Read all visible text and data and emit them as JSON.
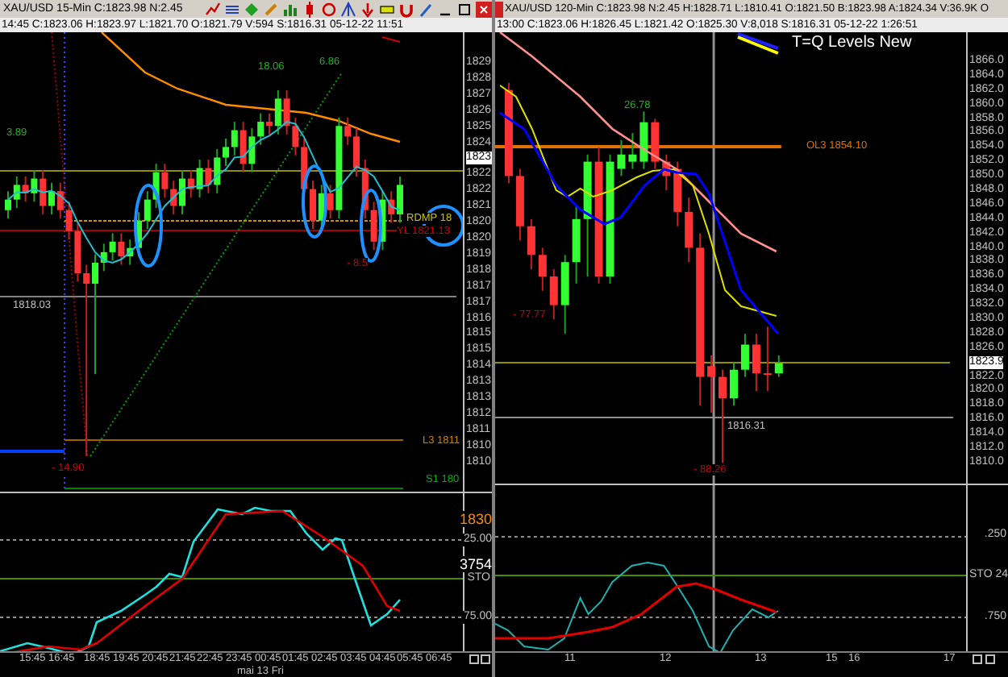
{
  "left_chart": {
    "title": "XAU/USD  15-Min  C:1823.98  N:2.45",
    "info": "14:45  C:1823.06  H:1823.97  L:1821.70  O:1821.79  V:594  S:1816.31  05-12-22  11:51",
    "price_labels": [
      {
        "text": "1829",
        "kind": "tick"
      },
      {
        "text": "1828",
        "kind": "tick"
      },
      {
        "text": "1827",
        "kind": "tick"
      },
      {
        "text": "1826",
        "kind": "tick"
      },
      {
        "text": "1825",
        "kind": "tick"
      },
      {
        "text": "1824",
        "kind": "tick"
      },
      {
        "text": "1823",
        "kind": "current"
      },
      {
        "text": "1822",
        "kind": "tick"
      },
      {
        "text": "1822",
        "kind": "tick"
      },
      {
        "text": "1821",
        "kind": "tick"
      },
      {
        "text": "1820",
        "kind": "tick"
      },
      {
        "text": "1820",
        "kind": "tick"
      },
      {
        "text": "1819",
        "kind": "tick"
      },
      {
        "text": "1818",
        "kind": "tick"
      },
      {
        "text": "1817",
        "kind": "tick"
      },
      {
        "text": "1817",
        "kind": "tick"
      },
      {
        "text": "1816",
        "kind": "tick"
      },
      {
        "text": "1815",
        "kind": "tick"
      },
      {
        "text": "1815",
        "kind": "tick"
      },
      {
        "text": "1814",
        "kind": "tick"
      },
      {
        "text": "1813",
        "kind": "tick"
      },
      {
        "text": "1813",
        "kind": "tick"
      },
      {
        "text": "1812",
        "kind": "tick"
      },
      {
        "text": "1811",
        "kind": "tick"
      },
      {
        "text": "1810",
        "kind": "tick"
      },
      {
        "text": "1810",
        "kind": "tick"
      }
    ],
    "annotations": [
      {
        "text": "3.89",
        "color": "#20b020"
      },
      {
        "text": "18.06",
        "color": "#20b020"
      },
      {
        "text": "6.86",
        "color": "#20b020"
      },
      {
        "text": "RDMP 18",
        "color": "#c8c000"
      },
      {
        "text": "YL 1821.13",
        "color": "#c80000"
      },
      {
        "text": "- 8.5",
        "color": "#c80000"
      },
      {
        "text": "1818.03",
        "color": "#c0c0c0"
      },
      {
        "text": "L3 1811",
        "color": "#c88000"
      },
      {
        "text": "- 14.90",
        "color": "#d00000"
      },
      {
        "text": "S1 180",
        "color": "#00b000"
      }
    ],
    "indicator_labels": [
      {
        "text": "1830",
        "color": "#ff8c00"
      },
      {
        "text": "25.00",
        "color": "#c0c0c0"
      },
      {
        "text": "3754",
        "color": "#ffffff"
      },
      {
        "text": "STO",
        "color": "#c0c0c0"
      },
      {
        "text": "75.00",
        "color": "#c0c0c0"
      }
    ],
    "time_labels": [
      "15:45",
      "16:45",
      "18:45",
      "19:45",
      "20:45",
      "21:45",
      "22:45",
      "23:45",
      "00:45",
      "01:45",
      "02:45",
      "03:45",
      "04:45",
      "05:45",
      "06:45"
    ],
    "date_label": "mai 13 Fri"
  },
  "right_chart": {
    "title": "XAU/USD  120-Min  C:1823.98  N:2.45  H:1828.71  L:1810.41  O:1821.50  B:1823.98  A:1824.34  V:36.9K  O",
    "info": "13:00  C:1823.06  H:1826.45  L:1821.42  O:1825.30  V:8,018  S:1816.31  05-12-22  1:26:51",
    "legend": "T=Q Levels New",
    "price_labels": [
      {
        "text": "1866.0",
        "kind": "tick"
      },
      {
        "text": "1864.0",
        "kind": "tick"
      },
      {
        "text": "1862.0",
        "kind": "tick"
      },
      {
        "text": "1860.0",
        "kind": "tick"
      },
      {
        "text": "1858.0",
        "kind": "tick"
      },
      {
        "text": "1856.0",
        "kind": "tick"
      },
      {
        "text": "1854.0",
        "kind": "tick"
      },
      {
        "text": "1852.0",
        "kind": "tick"
      },
      {
        "text": "1850.0",
        "kind": "tick"
      },
      {
        "text": "1848.0",
        "kind": "tick"
      },
      {
        "text": "1846.0",
        "kind": "tick"
      },
      {
        "text": "1844.0",
        "kind": "tick"
      },
      {
        "text": "1842.0",
        "kind": "tick"
      },
      {
        "text": "1840.0",
        "kind": "tick"
      },
      {
        "text": "1838.0",
        "kind": "tick"
      },
      {
        "text": "1836.0",
        "kind": "tick"
      },
      {
        "text": "1834.0",
        "kind": "tick"
      },
      {
        "text": "1832.0",
        "kind": "tick"
      },
      {
        "text": "1830.0",
        "kind": "tick"
      },
      {
        "text": "1828.0",
        "kind": "tick"
      },
      {
        "text": "1826.0",
        "kind": "tick"
      },
      {
        "text": "1823.9",
        "kind": "current"
      },
      {
        "text": "1822.0",
        "kind": "tick"
      },
      {
        "text": "1820.0",
        "kind": "tick"
      },
      {
        "text": "1818.0",
        "kind": "tick"
      },
      {
        "text": "1816.0",
        "kind": "tick"
      },
      {
        "text": "1814.0",
        "kind": "tick"
      },
      {
        "text": "1812.0",
        "kind": "tick"
      },
      {
        "text": "1810.0",
        "kind": "tick"
      }
    ],
    "annotations": [
      {
        "text": "26.78",
        "color": "#20b020"
      },
      {
        "text": "OL3 1854.10",
        "color": "#e07000"
      },
      {
        "text": "- 77.77",
        "color": "#c80000"
      },
      {
        "text": "1816.31",
        "color": "#c0c0c0"
      },
      {
        "text": "- 88.26",
        "color": "#c80000"
      }
    ],
    "indicator_labels": [
      {
        "text": ".250",
        "color": "#c0c0c0"
      },
      {
        "text": "STO 24",
        "color": "#c0c0c0"
      },
      {
        "text": ".750",
        "color": "#c0c0c0"
      }
    ],
    "time_labels": [
      "11",
      "12",
      "13",
      "15",
      "16",
      "17"
    ]
  }
}
